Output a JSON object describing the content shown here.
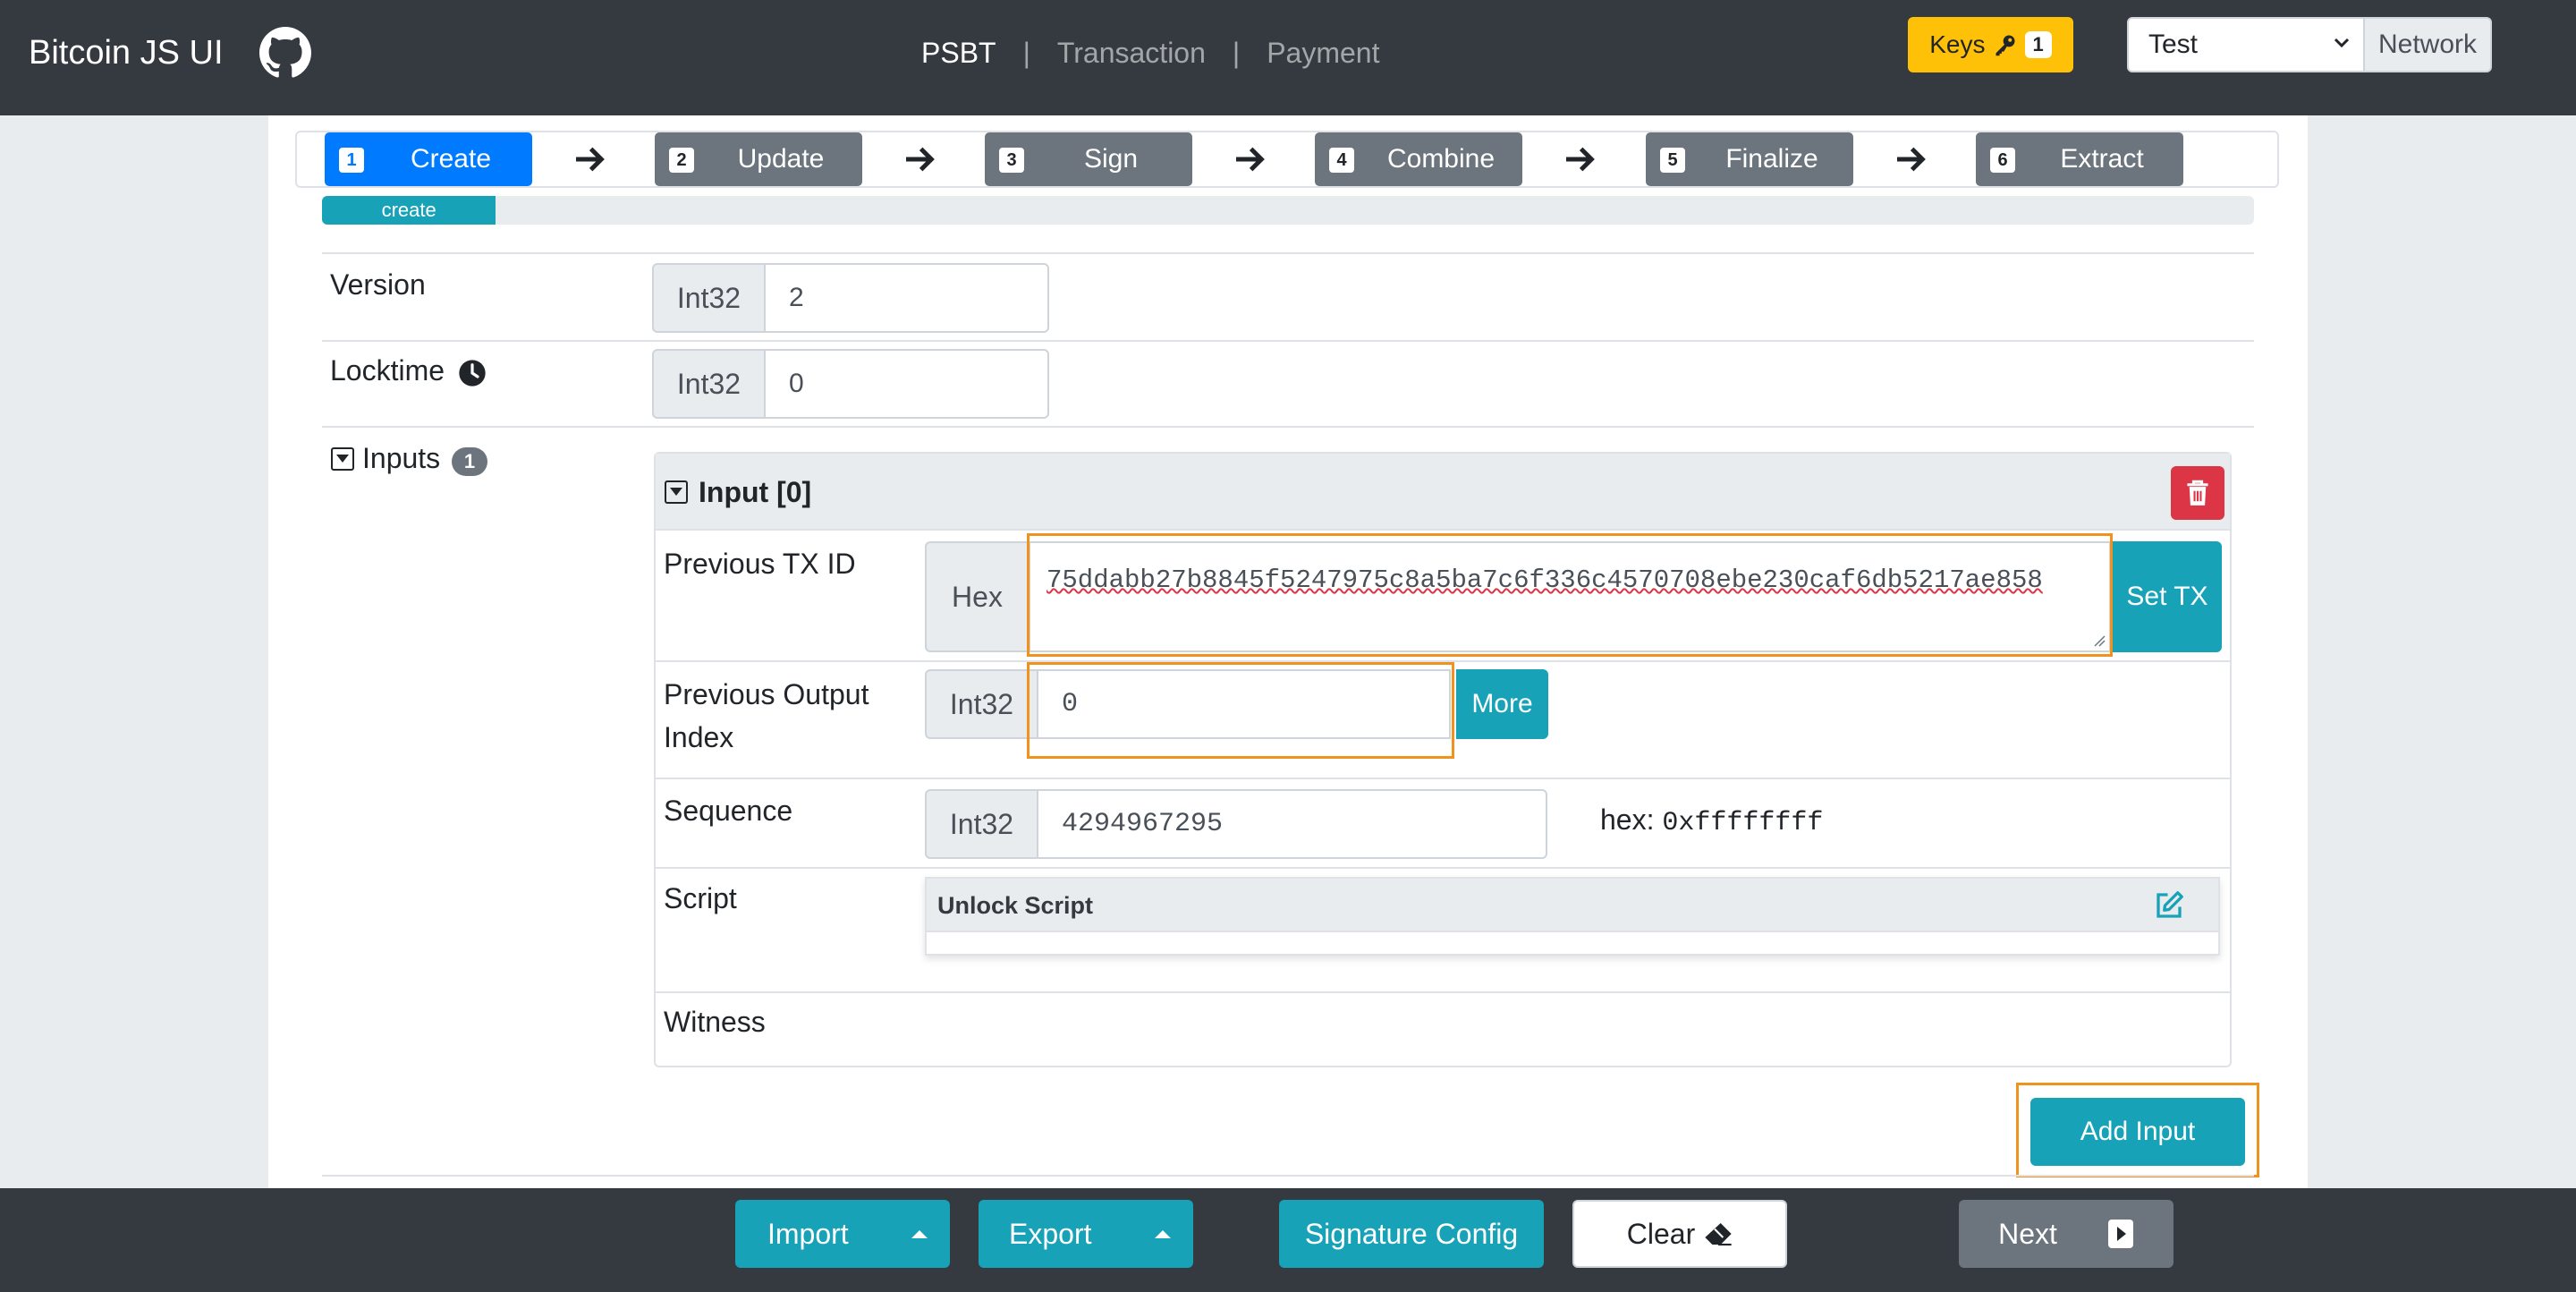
{
  "navbar": {
    "brand": "Bitcoin JS UI",
    "links": [
      "PSBT",
      "Transaction",
      "Payment"
    ],
    "separator": "|",
    "keys_label": "Keys",
    "keys_count": "1",
    "network_value": "Test",
    "network_label": "Network"
  },
  "steps": [
    {
      "num": "1",
      "label": "Create"
    },
    {
      "num": "2",
      "label": "Update"
    },
    {
      "num": "3",
      "label": "Sign"
    },
    {
      "num": "4",
      "label": "Combine"
    },
    {
      "num": "5",
      "label": "Finalize"
    },
    {
      "num": "6",
      "label": "Extract"
    }
  ],
  "progress": {
    "label": "create",
    "fraction": 0.09
  },
  "fields": {
    "version_label": "Version",
    "version_type": "Int32",
    "version_value": "2",
    "locktime_label": "Locktime",
    "locktime_type": "Int32",
    "locktime_value": "0"
  },
  "inputs": {
    "label": "Inputs",
    "count": "1",
    "card_title": "Input [0]",
    "prev_txid_label": "Previous TX ID",
    "prev_txid_type": "Hex",
    "prev_txid_value": "75ddabb27b8845f5247975c8a5ba7c6f336c4570708ebe230caf6db5217ae858",
    "set_tx_label": "Set TX",
    "prev_index_label_1": "Previous Output",
    "prev_index_label_2": "Index",
    "prev_index_type": "Int32",
    "prev_index_value": "0",
    "more_label": "More",
    "sequence_label": "Sequence",
    "sequence_type": "Int32",
    "sequence_value": "4294967295",
    "sequence_hex_label": "hex:",
    "sequence_hex_value": "0xffffffff",
    "script_label": "Script",
    "unlock_script_title": "Unlock Script",
    "witness_label": "Witness",
    "add_input_label": "Add Input"
  },
  "bottombar": {
    "import_label": "Import",
    "export_label": "Export",
    "signature_config_label": "Signature Config",
    "clear_label": "Clear",
    "next_label": "Next"
  },
  "colors": {
    "navbar": "#343a40",
    "primary": "#007bff",
    "info": "#17a2b8",
    "warning": "#ffc107",
    "danger": "#dc3545",
    "secondary": "#6c757d",
    "highlight": "#f0931e"
  },
  "icons": [
    "github-icon",
    "key-icon",
    "chevron-down-icon",
    "arrow-right-icon",
    "clock-icon",
    "caret-square-down-icon",
    "trash-icon",
    "edit-icon",
    "caret-up-icon",
    "eraser-icon",
    "caret-square-right-icon"
  ]
}
